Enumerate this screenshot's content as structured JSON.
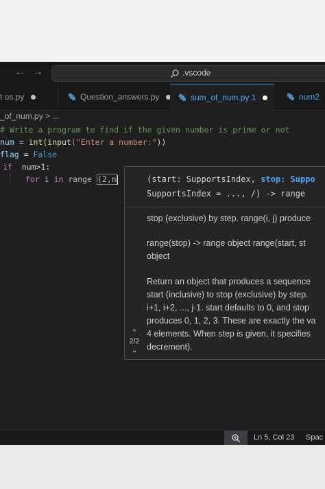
{
  "titlebar": {
    "search_label": ".vscode"
  },
  "tabs": [
    {
      "label": "rt os.py"
    },
    {
      "label": "Question_answers.py"
    },
    {
      "label": "sum_of_num.py 1"
    },
    {
      "label": "num2"
    }
  ],
  "breadcrumb": {
    "file": "_of_num.py",
    "separator": ">",
    "more": "..."
  },
  "code": {
    "line1_comment": "# Write a program to find if the given number is prime or not",
    "line2_var": "num",
    "line2_eq": " = ",
    "line2_int": "int",
    "line2_paren1": "(",
    "line2_input": "input",
    "line2_paren2": "(",
    "line2_str": "\"Enter a number:\"",
    "line2_close": "))",
    "line3_var": "flag",
    "line3_eq": " = ",
    "line3_val": "False",
    "line4_kw": "if",
    "line4_rest": "  num>1:",
    "line5_for": "for",
    "line5_i": " i ",
    "line5_in": "in",
    "line5_range": " range ",
    "line5_args": "(2,n"
  },
  "signature_help": {
    "sig_line1_pre": "(start: SupportsIndex, ",
    "sig_line1_active": "stop: Suppo",
    "sig_line2": "SupportsIndex = ..., /) -> range",
    "doc_1": "stop (exclusive) by step. range(i, j) produce",
    "doc_2": "range(stop) -> range object range(start, st\nobject",
    "doc_3": "Return an object that produces a sequence\nstart (inclusive) to stop (exclusive) by step.\ni+1, i+2, ..., j-1. start defaults to 0, and stop\nproduces 0, 1, 2, 3. These are exactly the va\n4 elements. When step is given, it specifies\ndecrement).",
    "counter": "2/2"
  },
  "statusbar": {
    "position": "Ln 5, Col 23",
    "spaces": "Spac"
  },
  "colors": {
    "background": "#1f1f1f",
    "accent": "#4fa6f5",
    "comment": "#6a9955"
  },
  "icons": [
    "arrow-left-icon",
    "arrow-right-icon",
    "search-icon",
    "python-file-icon",
    "zoom-icon",
    "chevron-up-icon",
    "chevron-down-icon"
  ]
}
